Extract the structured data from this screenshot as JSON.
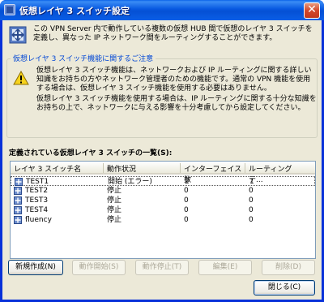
{
  "window": {
    "title": "仮想レイヤ 3 スイッチ設定",
    "close_glyph": "✕"
  },
  "intro": {
    "text": "この VPN Server 内で動作している複数の仮想 HUB 間で仮想のレイヤ 3 スイッチを定義し、異なった IP ネットワーク間をルーティングすることができます。"
  },
  "notice": {
    "caption": "仮想レイヤ 3 スイッチ機能に関するご注意",
    "para1": "仮想レイヤ 3 スイッチ機能は、ネットワークおよび IP ルーティングに関する詳しい知識をお持ちの方やネットワーク管理者のための機能です。通常の VPN 機能を使用する場合は、仮想レイヤ 3 スイッチ機能を使用する必要はありません。",
    "para2": "仮想レイヤ 3 スイッチ機能を使用する場合は、IP ルーティングに関する十分な知識をお持ちの上で、ネットワークに与える影響を十分考慮してから設定してください。"
  },
  "list": {
    "caption": "定義されている仮想レイヤ 3 スイッチの一覧(S):",
    "columns": [
      "レイヤ 3 スイッチ名",
      "動作状況",
      "インターフェイス数",
      "ルーティングテ..."
    ],
    "rows": [
      {
        "name": "TEST1",
        "status": "開始 (エラー)",
        "interfaces": "2",
        "routes": "1"
      },
      {
        "name": "TEST2",
        "status": "停止",
        "interfaces": "0",
        "routes": "0"
      },
      {
        "name": "TEST3",
        "status": "停止",
        "interfaces": "0",
        "routes": "0"
      },
      {
        "name": "TEST4",
        "status": "停止",
        "interfaces": "0",
        "routes": "0"
      },
      {
        "name": "fluency",
        "status": "停止",
        "interfaces": "0",
        "routes": "0"
      }
    ]
  },
  "buttons": {
    "new": "新規作成(N)",
    "start": "動作開始(S)",
    "stop": "動作停止(T)",
    "edit": "編集(E)",
    "delete": "削除(D)",
    "close": "閉じる(C)"
  },
  "colors": {
    "title_blue": "#0758e0",
    "caption_blue": "#0046d5",
    "face": "#ece9d8"
  }
}
